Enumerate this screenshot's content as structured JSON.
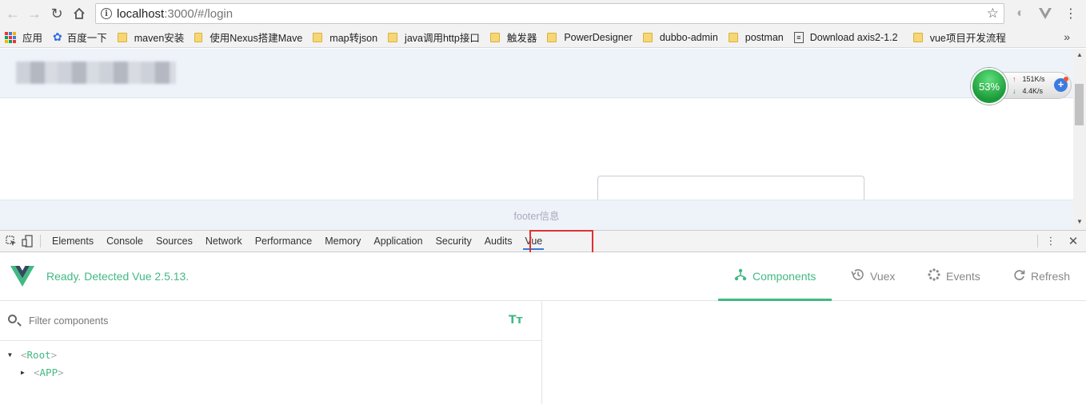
{
  "browser": {
    "url_host": "localhost",
    "url_path": ":3000/#/login",
    "bookmarks": [
      {
        "label": "应用",
        "icon": "apps-icon"
      },
      {
        "label": "百度一下",
        "icon": "baidu-paw-icon"
      },
      {
        "label": "maven安装",
        "icon": "folder-icon"
      },
      {
        "label": "使用Nexus搭建Mave",
        "icon": "folder-icon"
      },
      {
        "label": "map转json",
        "icon": "folder-icon"
      },
      {
        "label": "java调用http接口",
        "icon": "folder-icon"
      },
      {
        "label": "触发器",
        "icon": "folder-icon"
      },
      {
        "label": "PowerDesigner",
        "icon": "folder-icon"
      },
      {
        "label": "dubbo-admin",
        "icon": "folder-icon"
      },
      {
        "label": "postman",
        "icon": "folder-icon"
      },
      {
        "label": "Download axis2-1.2",
        "icon": "page-icon"
      },
      {
        "label": "vue项目开发流程",
        "icon": "folder-icon"
      }
    ],
    "more": "»"
  },
  "page": {
    "footer_text": "footer信息"
  },
  "speed_widget": {
    "percent": "53%",
    "upload": "151K/s",
    "download": "4.4K/s",
    "up_arrow": "↑",
    "down_arrow": "↓"
  },
  "devtools": {
    "tabs": [
      "Elements",
      "Console",
      "Sources",
      "Network",
      "Performance",
      "Memory",
      "Application",
      "Security",
      "Audits",
      "Vue"
    ],
    "active_tab": "Vue"
  },
  "vue": {
    "status": "Ready. Detected Vue 2.5.13.",
    "tabs": [
      {
        "label": "Components",
        "icon": "components-icon",
        "active": true
      },
      {
        "label": "Vuex",
        "icon": "history-icon",
        "active": false
      },
      {
        "label": "Events",
        "icon": "events-icon",
        "active": false
      },
      {
        "label": "Refresh",
        "icon": "refresh-icon",
        "active": false
      }
    ],
    "filter_placeholder": "Filter components",
    "tt_label": "Tт",
    "tree": [
      {
        "name": "Root",
        "expanded": true,
        "depth": 0
      },
      {
        "name": "APP",
        "expanded": false,
        "depth": 1
      }
    ]
  },
  "colors": {
    "vue_green": "#42b983",
    "highlight_red": "#e0312f",
    "active_tab_blue": "#3879d9"
  }
}
